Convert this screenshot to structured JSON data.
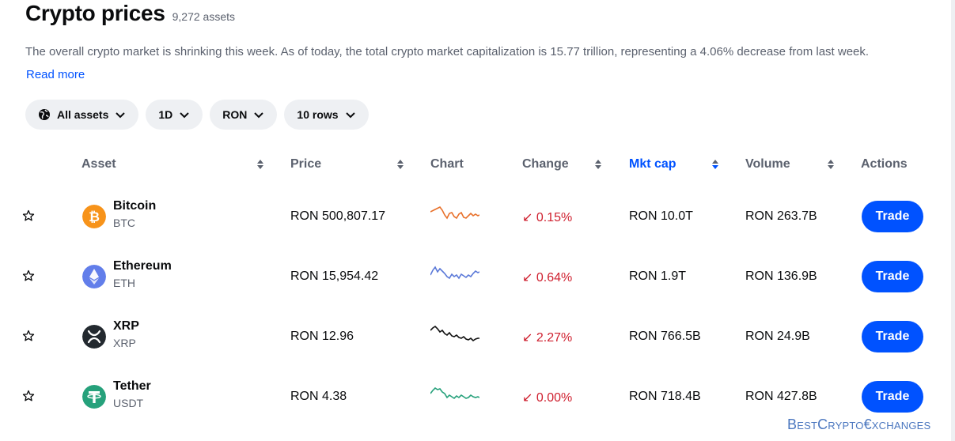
{
  "header": {
    "title": "Crypto prices",
    "asset_count": "9,272 assets"
  },
  "summary": {
    "text": "The overall crypto market is shrinking this week. As of today, the total crypto market capitalization is 15.77 trillion, representing a 4.06% decrease from last week.",
    "read_more": "Read more"
  },
  "filters": {
    "assets": "All assets",
    "timeframe": "1D",
    "currency": "RON",
    "rows": "10 rows"
  },
  "columns": {
    "asset": "Asset",
    "price": "Price",
    "chart": "Chart",
    "change": "Change",
    "mkt_cap": "Mkt cap",
    "volume": "Volume",
    "actions": "Actions"
  },
  "rows": [
    {
      "name": "Bitcoin",
      "symbol": "BTC",
      "price": "RON 500,807.17",
      "change": "0.15%",
      "mkt_cap": "RON 10.0T",
      "volume": "RON 263.7B",
      "action": "Trade",
      "icon": "bitcoin-icon",
      "color": "#f7931a",
      "spark_color": "#e8702a"
    },
    {
      "name": "Ethereum",
      "symbol": "ETH",
      "price": "RON 15,954.42",
      "change": "0.64%",
      "mkt_cap": "RON 1.9T",
      "volume": "RON 136.9B",
      "action": "Trade",
      "icon": "ethereum-icon",
      "color": "#627eea",
      "spark_color": "#5b79d8"
    },
    {
      "name": "XRP",
      "symbol": "XRP",
      "price": "RON 12.96",
      "change": "2.27%",
      "mkt_cap": "RON 766.5B",
      "volume": "RON 24.9B",
      "action": "Trade",
      "icon": "xrp-icon",
      "color": "#23292f",
      "spark_color": "#111111"
    },
    {
      "name": "Tether",
      "symbol": "USDT",
      "price": "RON 4.38",
      "change": "0.00%",
      "mkt_cap": "RON 718.4B",
      "volume": "RON 427.8B",
      "action": "Trade",
      "icon": "tether-icon",
      "color": "#26a17b",
      "spark_color": "#26a17b"
    }
  ],
  "colors": {
    "accent": "#0052ff",
    "negative": "#cf202f",
    "pill_bg": "#eef0f3"
  },
  "watermark": "BestCrypto€xchanges"
}
